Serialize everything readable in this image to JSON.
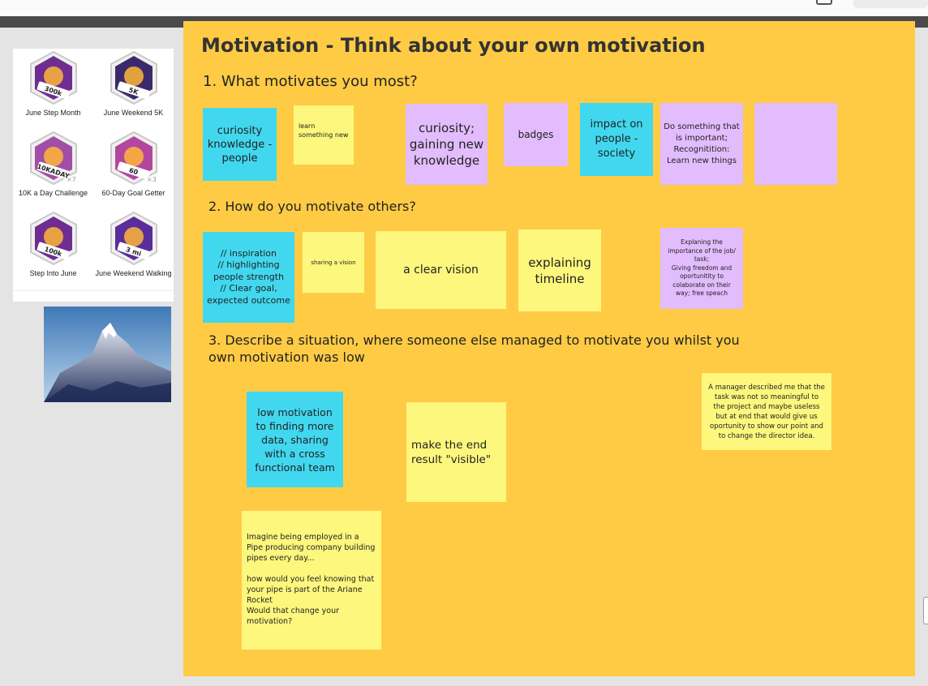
{
  "board": {
    "title": "Motivation - Think about your own motivation",
    "q1": "1. What motivates you most?",
    "q2": "2. How do you motivate others?",
    "q3": "3. Describe a situation, where someone else managed to motivate you whilst you\nown motivation was low"
  },
  "badges": [
    {
      "label": "June Step Month",
      "emblem": "300k",
      "icon": "runner-badge-icon",
      "color": "#6f2d91"
    },
    {
      "label": "June Weekend 5K",
      "emblem": "5K",
      "icon": "shoe-badge-icon",
      "color": "#3a2a6b"
    },
    {
      "label": "10K a Day Challenge",
      "emblem": "10KADAY",
      "icon": "shoe-badge-icon",
      "multiplier": "×7",
      "color": "#a14ea6"
    },
    {
      "label": "60-Day Goal Getter",
      "emblem": "60",
      "icon": "target-badge-icon",
      "multiplier": "×3",
      "color": "#b3479f"
    },
    {
      "label": "Step Into June",
      "emblem": "100k",
      "icon": "runner-badge-icon",
      "color": "#6f2d91"
    },
    {
      "label": "June Weekend Walking",
      "emblem": "3 mi",
      "icon": "walk-badge-icon",
      "color": "#5a2d9c"
    }
  ],
  "notes": {
    "n1": "curiosity knowledge - people",
    "n2": "learn something new",
    "n3": "curiosity; gaining new knowledge",
    "n4": "badges",
    "n5": "impact on people - society",
    "n6": "Do something that is important; Recognitition: Learn new things",
    "n7": "",
    "m1": "// inspiration\n// highlighting people strength\n// Clear goal, expected outcome",
    "m2": "sharing a vision",
    "m3": "a clear vision",
    "m4": "explaining timeline",
    "m5": "Explaning the importance of the job/ task;\nGiving freedom and oportunitity to colaborate on their way; free speach",
    "s1": "low motivation to finding more data,  sharing with a cross functional team",
    "s2": "make the end result \"visible\"",
    "s3": "A manager described me that the task was not so meaningful to the project and maybe useless but at end that would give us oportunity to show our point and to change the director idea.",
    "s4": "Imagine being employed in a Pipe producing company building pipes every day...\n\nhow would you feel knowing that your pipe is part of the Ariane Rocket\nWould that change your motivation?"
  },
  "colors": {
    "board": "#ffcb45",
    "yellow_note": "#fdf77d",
    "cyan_note": "#41d8ef",
    "purple_note": "#e2bcfc"
  }
}
